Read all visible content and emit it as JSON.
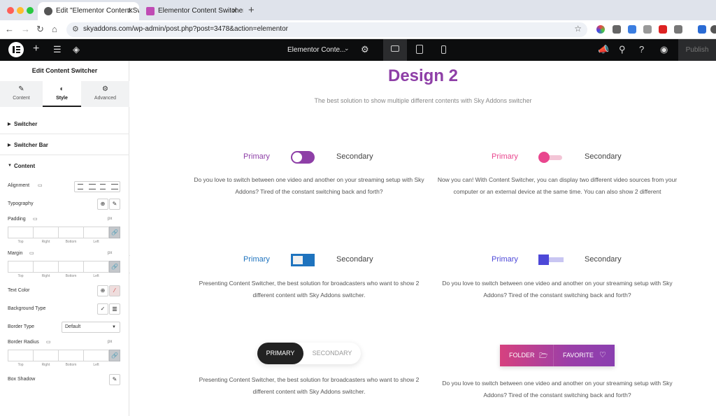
{
  "browser": {
    "tabs": [
      {
        "title": "Edit \"Elementor Content Swit",
        "active": true
      },
      {
        "title": "Elementor Content Switcher –",
        "active": false
      }
    ],
    "url": "skyaddons.com/wp-admin/post.php?post=3478&action=elementor"
  },
  "editor_bar": {
    "document_title": "Elementor Conte...",
    "publish_label": "Publish"
  },
  "panel": {
    "title": "Edit Content Switcher",
    "tabs": [
      {
        "label": "Content",
        "icon": "pencil-icon",
        "active": false
      },
      {
        "label": "Style",
        "icon": "contrast-icon",
        "active": true
      },
      {
        "label": "Advanced",
        "icon": "gear-icon",
        "active": false
      }
    ],
    "sections": [
      {
        "label": "Switcher",
        "expanded": false
      },
      {
        "label": "Switcher Bar",
        "expanded": false
      },
      {
        "label": "Content",
        "expanded": true
      }
    ],
    "controls": {
      "alignment": "Alignment",
      "typography": "Typography",
      "padding": "Padding",
      "margin": "Margin",
      "text_color": "Text Color",
      "background_type": "Background Type",
      "border_type": "Border Type",
      "border_type_value": "Default",
      "border_radius": "Border Radius",
      "box_shadow": "Box Shadow",
      "unit": "px",
      "dim_labels": [
        "Top",
        "Right",
        "Bottom",
        "Left"
      ]
    }
  },
  "canvas": {
    "heading": "Design 2",
    "subheading": "The best solution to show multiple different contents with Sky Addons switcher",
    "colors": {
      "purple": "#8e3fa7",
      "pink": "#e9468e",
      "blue": "#1e73be",
      "indigo": "#4d48d8"
    },
    "switchers": [
      {
        "primary": "Primary",
        "secondary": "Secondary",
        "text": "Do you love to switch between one video and another on your streaming setup with Sky Addons? Tired of the constant switching back and forth?"
      },
      {
        "primary": "Primary",
        "secondary": "Secondary",
        "text": "Now you can! With Content Switcher, you can display two different video sources from your computer or an external device at the same time. You can also show 2 different"
      },
      {
        "primary": "Primary",
        "secondary": "Secondary",
        "text": "Presenting Content Switcher, the best solution for broadcasters who want to show 2 different content with Sky Addons switcher."
      },
      {
        "primary": "Primary",
        "secondary": "Secondary",
        "text": "Do you love to switch between one video and another on your streaming setup with Sky Addons? Tired of the constant switching back and forth?"
      },
      {
        "primary": "PRIMARY",
        "secondary": "SECONDARY",
        "text": "Presenting Content Switcher, the best solution for broadcasters who want to show 2 different content with Sky Addons switcher."
      },
      {
        "primary": "FOLDER",
        "secondary": "FAVORITE",
        "text": "Do you love to switch between one video and another on your streaming setup with Sky Addons? Tired of the constant switching back and forth?"
      }
    ]
  }
}
